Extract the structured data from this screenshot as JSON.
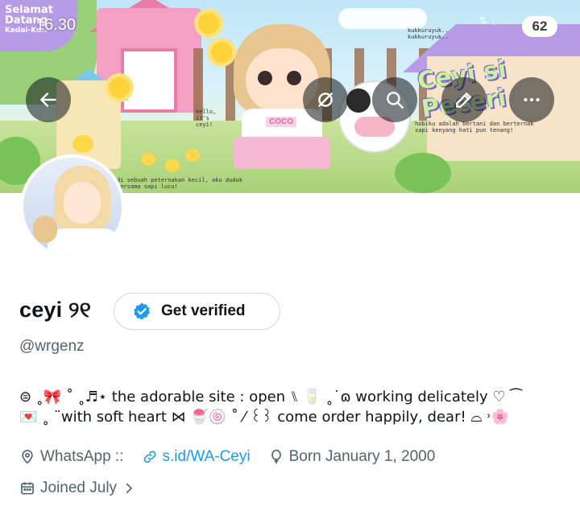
{
  "status_bar": {
    "overlay_text_1": "Selamat",
    "overlay_text_2": "Datang",
    "overlay_text_3": "Kedai-Ku..",
    "time": "16.30",
    "notification_count": "62"
  },
  "banner": {
    "logo_text": "Ceyi si Peceri",
    "caption_hello": "hello, it's ceyi!",
    "caption_rooster": "kukkuruyuk.. kukkuruyuk..",
    "caption_story": "di sebuah peternakan kecil, aku duduk bersama sapi lucu!",
    "caption_hobby": "hobiku adalah bertani dan berternak sapi kenyang hati pun tenang!",
    "shirt_text": "COCO"
  },
  "nav": {
    "back_icon": "arrow-left-icon",
    "hide_icon": "eye-slash-icon",
    "search_icon": "search-icon",
    "edit_icon": "pencil-icon",
    "more_icon": "more-horizontal-icon"
  },
  "profile": {
    "name": "ceyi ୨୧",
    "verify_label": "Get verified",
    "handle": "@wrgenz",
    "bio_line_1": "⊜ ˳🎀 ˚ ˳♬⋆ the adorable site : open ⑊ 🥛 ˳˙ɷ working delicately ♡ ⁀",
    "bio_line_2": "💌 ˳ ¨with soft heart ⋈ 🍧🍥 ˚ ⁄ ꒰꒱ come order happily, dear! ⌓ ˒🌸",
    "location": "WhatsApp ::",
    "link": "s.id/WA-Ceyi",
    "birthday": "Born January 1, 2000",
    "joined": "Joined July"
  },
  "colors": {
    "accent": "#1d9bf0",
    "secondary_text": "#536471",
    "primary_text": "#0f1419",
    "border": "#cfd9de"
  }
}
